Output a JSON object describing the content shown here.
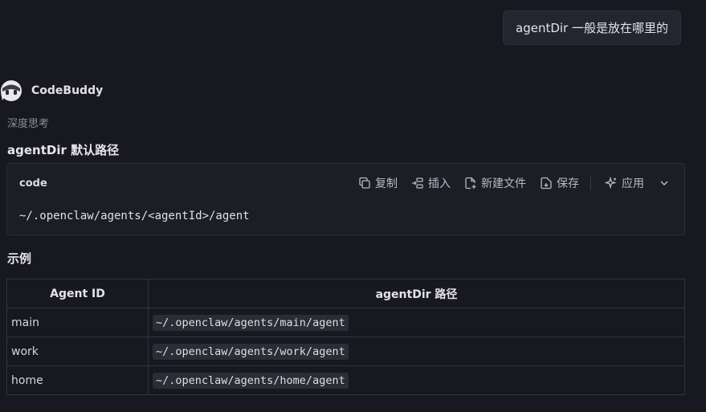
{
  "user_message": "agentDir 一般是放在哪里的",
  "assistant": {
    "name": "CodeBuddy",
    "thinking_label": "深度思考"
  },
  "section1": {
    "title": "agentDir 默认路径"
  },
  "code_block": {
    "language": "code",
    "toolbar": {
      "copy": "复制",
      "insert": "插入",
      "new_file": "新建文件",
      "save": "保存",
      "apply": "应用"
    },
    "content": "~/.openclaw/agents/<agentId>/agent"
  },
  "section2": {
    "title": "示例"
  },
  "table": {
    "headers": [
      "Agent ID",
      "agentDir 路径"
    ],
    "rows": [
      [
        "main",
        "~/.openclaw/agents/main/agent"
      ],
      [
        "work",
        "~/.openclaw/agents/work/agent"
      ],
      [
        "home",
        "~/.openclaw/agents/home/agent"
      ]
    ]
  }
}
